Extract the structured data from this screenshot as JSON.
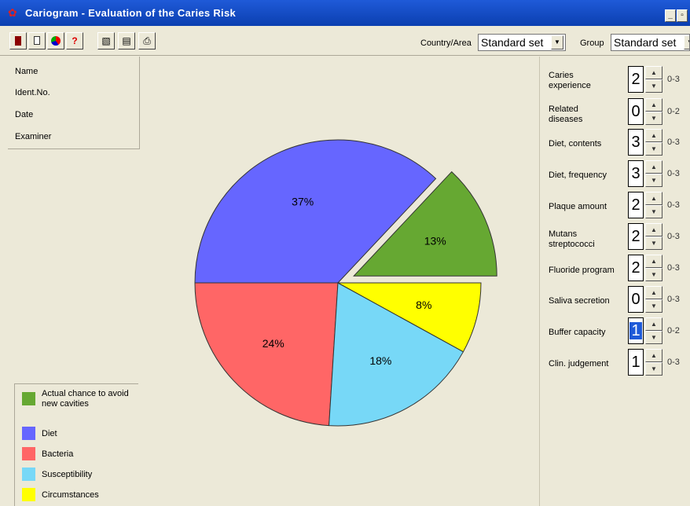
{
  "window": {
    "title": "Cariogram - Evaluation of the Caries Risk",
    "minimize_label": "_",
    "restore_label": "▫"
  },
  "toolbar": {
    "icons": [
      "exit-icon",
      "new-document-icon",
      "pie-chart-icon",
      "help-icon",
      "report-icon",
      "notes-icon",
      "print-icon"
    ],
    "country_label": "Country/Area",
    "country_value": "Standard set",
    "group_label": "Group",
    "group_value": "Standard set"
  },
  "patient_info": {
    "labels": [
      "Name",
      "Ident.No.",
      "Date",
      "Examiner"
    ]
  },
  "parameters": [
    {
      "line1": "Caries",
      "line2": "experience",
      "value": "2",
      "range": "0-3"
    },
    {
      "line1": "Related",
      "line2": "diseases",
      "value": "0",
      "range": "0-2"
    },
    {
      "line1": "Diet, contents",
      "line2": "",
      "value": "3",
      "range": "0-3"
    },
    {
      "line1": "Diet, frequency",
      "line2": "",
      "value": "3",
      "range": "0-3"
    },
    {
      "line1": "Plaque amount",
      "line2": "",
      "value": "2",
      "range": "0-3"
    },
    {
      "line1": "Mutans",
      "line2": "streptococci",
      "value": "2",
      "range": "0-3"
    },
    {
      "line1": "Fluoride program",
      "line2": "",
      "value": "2",
      "range": "0-3"
    },
    {
      "line1": "Saliva secretion",
      "line2": "",
      "value": "0",
      "range": "0-3"
    },
    {
      "line1": "Buffer capacity",
      "line2": "",
      "value": "1",
      "range": "0-2"
    },
    {
      "line1": "Clin. judgement",
      "line2": "",
      "value": "1",
      "range": "0-3"
    }
  ],
  "legend": {
    "items": [
      {
        "line1": "Actual chance to avoid",
        "line2": "new cavities",
        "color": "#66a832"
      },
      {
        "line1": "Diet",
        "line2": "",
        "color": "#6666ff"
      },
      {
        "line1": "Bacteria",
        "line2": "",
        "color": "#ff6666"
      },
      {
        "line1": "Susceptibility",
        "line2": "",
        "color": "#77d8f7"
      },
      {
        "line1": "Circumstances",
        "line2": "",
        "color": "#ffff00"
      }
    ]
  },
  "chart_data": {
    "type": "pie",
    "slices": [
      {
        "label": "13%",
        "value": 13,
        "color": "#66a832",
        "exploded": true
      },
      {
        "label": "37%",
        "value": 37,
        "color": "#6666ff",
        "exploded": false
      },
      {
        "label": "24%",
        "value": 24,
        "color": "#ff6666",
        "exploded": false
      },
      {
        "label": "18%",
        "value": 18,
        "color": "#77d8f7",
        "exploded": false
      },
      {
        "label": "8%",
        "value": 8,
        "color": "#ffff00",
        "exploded": false
      }
    ]
  }
}
